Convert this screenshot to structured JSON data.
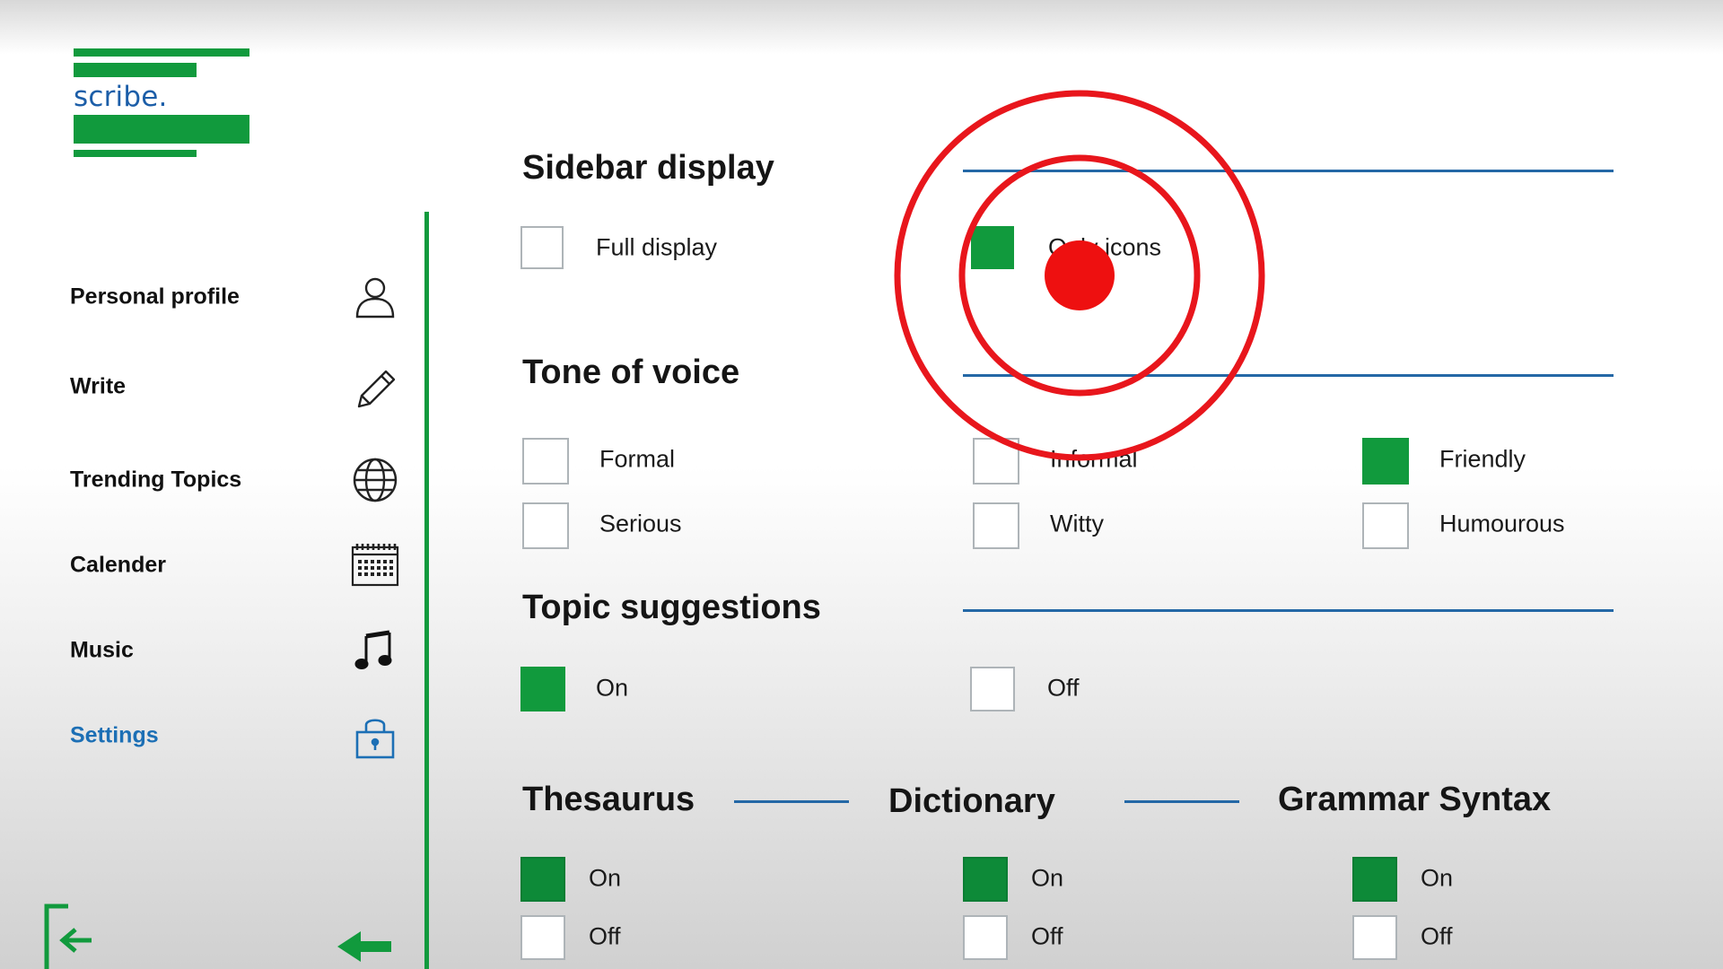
{
  "app": {
    "logo_text": "scribe."
  },
  "sidebar": {
    "items": [
      {
        "label": "Personal profile",
        "icon": "user-icon",
        "active": false
      },
      {
        "label": "Write",
        "icon": "pencil-icon",
        "active": false
      },
      {
        "label": "Trending Topics",
        "icon": "globe-icon",
        "active": false
      },
      {
        "label": "Calender",
        "icon": "calendar-icon",
        "active": false
      },
      {
        "label": "Music",
        "icon": "music-note-icon",
        "active": false
      },
      {
        "label": "Settings",
        "icon": "lock-icon",
        "active": true
      }
    ],
    "bottom_icons": [
      "logout-icon",
      "collapse-arrow-icon"
    ]
  },
  "settings": {
    "sidebar_display": {
      "title": "Sidebar display",
      "options": [
        {
          "label": "Full display",
          "checked": false
        },
        {
          "label": "Only icons",
          "checked": true
        }
      ]
    },
    "tone_of_voice": {
      "title": "Tone of voice",
      "options": [
        {
          "label": "Formal",
          "checked": false
        },
        {
          "label": "Informal",
          "checked": false
        },
        {
          "label": "Friendly",
          "checked": true
        },
        {
          "label": "Serious",
          "checked": false
        },
        {
          "label": "Witty",
          "checked": false
        },
        {
          "label": "Humourous",
          "checked": false
        }
      ]
    },
    "topic_suggestions": {
      "title": "Topic suggestions",
      "options": [
        {
          "label": "On",
          "checked": true
        },
        {
          "label": "Off",
          "checked": false
        }
      ]
    },
    "thesaurus": {
      "title": "Thesaurus",
      "options": [
        {
          "label": "On",
          "checked": true
        },
        {
          "label": "Off",
          "checked": false
        }
      ]
    },
    "dictionary": {
      "title": "Dictionary",
      "options": [
        {
          "label": "On",
          "checked": true
        },
        {
          "label": "Off",
          "checked": false
        }
      ]
    },
    "grammar_syntax": {
      "title": "Grammar Syntax",
      "options": [
        {
          "label": "On",
          "checked": true
        },
        {
          "label": "Off",
          "checked": false
        }
      ]
    }
  },
  "colors": {
    "accent_green": "#119a3d",
    "rule_blue": "#2468a6",
    "active_blue": "#1c6fb5",
    "annotation_red": "#e8161c"
  },
  "annotation": {
    "type": "click-target-marker"
  }
}
